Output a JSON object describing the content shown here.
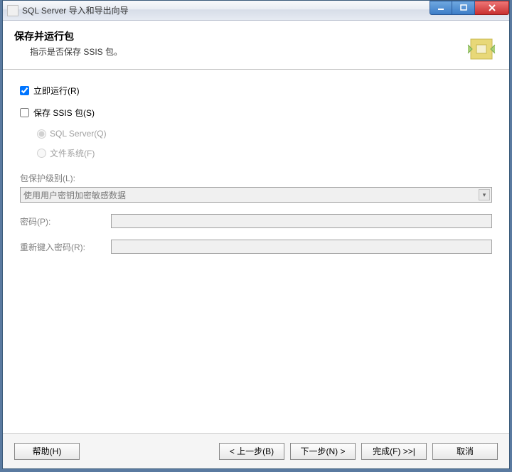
{
  "window": {
    "title": "SQL Server 导入和导出向导"
  },
  "header": {
    "title": "保存并运行包",
    "subtitle": "指示是否保存 SSIS 包。"
  },
  "options": {
    "run_now_label": "立即运行(R)",
    "run_now_checked": true,
    "save_ssis_label": "保存 SSIS 包(S)",
    "save_ssis_checked": false,
    "radio_sqlserver_label": "SQL Server(Q)",
    "radio_filesystem_label": "文件系统(F)"
  },
  "protection": {
    "section_label": "包保护级别(L):",
    "selected_value": "使用用户密钥加密敏感数据",
    "password_label": "密码(P):",
    "retype_label": "重新键入密码(R):",
    "password_value": "",
    "retype_value": ""
  },
  "footer": {
    "help": "帮助(H)",
    "back": "< 上一步(B)",
    "next": "下一步(N) >",
    "finish": "完成(F) >>|",
    "cancel": "取消"
  }
}
